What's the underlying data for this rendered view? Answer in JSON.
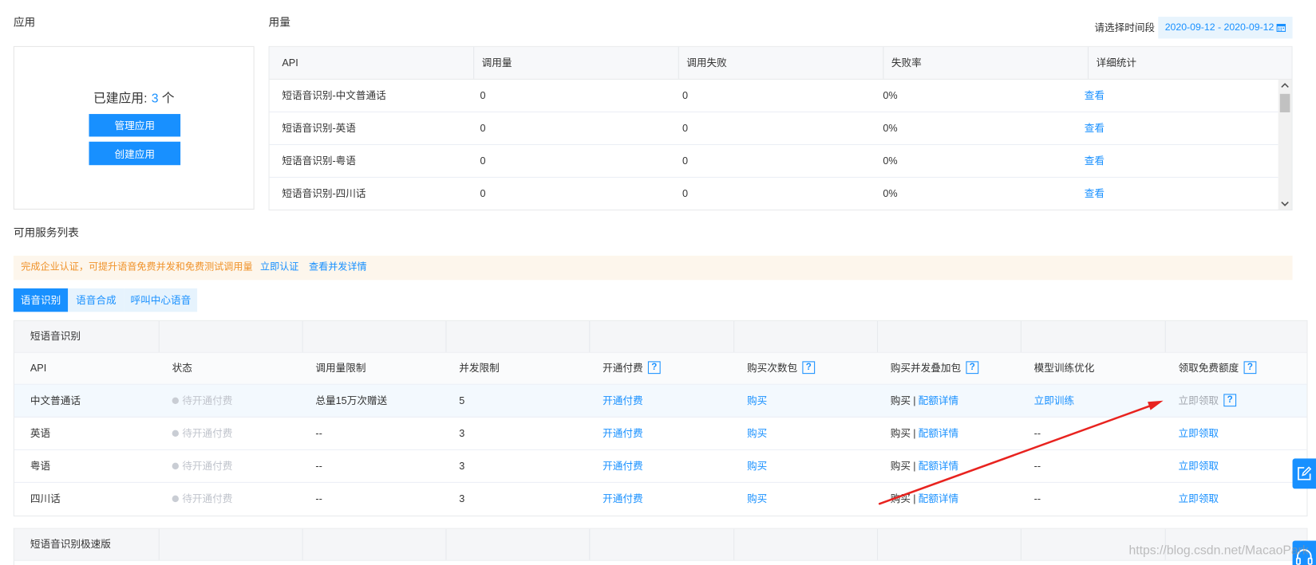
{
  "apps": {
    "title": "应用",
    "created_label": "已建应用:",
    "created_count": "3",
    "created_unit": "个",
    "manage_button": "管理应用",
    "create_button": "创建应用"
  },
  "usage": {
    "title": "用量",
    "date_label": "请选择时间段",
    "date_range": "2020-09-12 - 2020-09-12",
    "columns": [
      "API",
      "调用量",
      "调用失败",
      "失败率",
      "详细统计"
    ],
    "rows": [
      {
        "api": "短语音识别-中文普通话",
        "calls": "0",
        "failures": "0",
        "failure_rate": "0%",
        "detail": "查看"
      },
      {
        "api": "短语音识别-英语",
        "calls": "0",
        "failures": "0",
        "failure_rate": "0%",
        "detail": "查看"
      },
      {
        "api": "短语音识别-粤语",
        "calls": "0",
        "failures": "0",
        "failure_rate": "0%",
        "detail": "查看"
      },
      {
        "api": "短语音识别-四川话",
        "calls": "0",
        "failures": "0",
        "failure_rate": "0%",
        "detail": "查看"
      }
    ]
  },
  "services": {
    "title": "可用服务列表",
    "notice": {
      "text": "完成企业认证，可提升语音免费并发和免费测试调用量",
      "certify_link": "立即认证",
      "concurrency_link": "查看并发详情"
    },
    "tabs": [
      {
        "label": "语音识别",
        "active": true
      },
      {
        "label": "语音合成",
        "active": false
      },
      {
        "label": "呼叫中心语音",
        "active": false
      }
    ],
    "groups": [
      {
        "name": "短语音识别",
        "columns": [
          "API",
          "状态",
          "调用量限制",
          "并发限制",
          "开通付费",
          "购买次数包",
          "购买并发叠加包",
          "模型训练优化",
          "领取免费额度"
        ],
        "rows": [
          {
            "api": "中文普通话",
            "status": "待开通付费",
            "call_limit": "总量15万次赠送",
            "concurrency_limit": "5",
            "activate": "开通付费",
            "buy_pack": "购买",
            "buy_concurrency": "购买",
            "separator": "|",
            "quota_detail": "配额详情",
            "model_training": "立即训练",
            "free_quota": "立即领取",
            "free_quota_enabled": false
          },
          {
            "api": "英语",
            "status": "待开通付费",
            "call_limit": "--",
            "concurrency_limit": "3",
            "activate": "开通付费",
            "buy_pack": "购买",
            "buy_concurrency": "购买",
            "separator": "|",
            "quota_detail": "配额详情",
            "model_training": "--",
            "free_quota": "立即领取",
            "free_quota_enabled": true
          },
          {
            "api": "粤语",
            "status": "待开通付费",
            "call_limit": "--",
            "concurrency_limit": "3",
            "activate": "开通付费",
            "buy_pack": "购买",
            "buy_concurrency": "购买",
            "separator": "|",
            "quota_detail": "配额详情",
            "model_training": "--",
            "free_quota": "立即领取",
            "free_quota_enabled": true
          },
          {
            "api": "四川话",
            "status": "待开通付费",
            "call_limit": "--",
            "concurrency_limit": "3",
            "activate": "开通付费",
            "buy_pack": "购买",
            "buy_concurrency": "购买",
            "separator": "|",
            "quota_detail": "配额详情",
            "model_training": "--",
            "free_quota": "立即领取",
            "free_quota_enabled": true
          }
        ]
      },
      {
        "name": "短语音识别极速版"
      }
    ]
  },
  "watermark": "https://blog.csdn.net/MacaoPark",
  "icons": {
    "date_picker": "calendar-icon",
    "help": "help-icon",
    "status": "status-dot-icon",
    "scroll_up": "chevron-up-icon",
    "scroll_down": "chevron-down-icon",
    "edit": "edit-icon",
    "support": "headset-icon"
  },
  "colors": {
    "primary": "#1890ff",
    "notice_text": "#f0932b",
    "notice_background": "#fdf6ec",
    "tab_inactive_background": "#e6f3fd",
    "status_inactive": "#c0c4cc",
    "annotation_arrow": "#e8231f"
  }
}
